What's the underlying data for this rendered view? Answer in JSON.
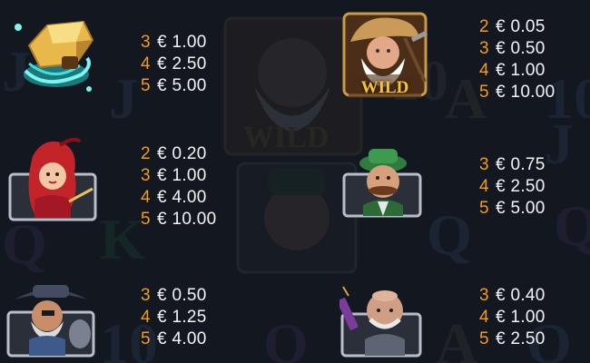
{
  "theme": {
    "count_color": "#f39c1f",
    "amount_color": "#f4f4f4",
    "background": "#121720"
  },
  "background_letters": [
    "J",
    "J",
    "A",
    "10",
    "10",
    "J",
    "K",
    "Q",
    "Q",
    "10",
    "Q",
    "Q",
    "A",
    "Q"
  ],
  "background_wild_label": "WILD",
  "paytable": [
    {
      "icon": "gold-nugget-icon",
      "pays": [
        {
          "count": "3",
          "amount": "€ 1.00"
        },
        {
          "count": "4",
          "amount": "€ 2.50"
        },
        {
          "count": "5",
          "amount": "€ 5.00"
        }
      ]
    },
    {
      "icon": "wild-miner-icon",
      "label": "WILD",
      "pays": [
        {
          "count": "2",
          "amount": "€ 0.05"
        },
        {
          "count": "3",
          "amount": "€ 0.50"
        },
        {
          "count": "4",
          "amount": "€ 1.00"
        },
        {
          "count": "5",
          "amount": "€ 10.00"
        }
      ]
    },
    {
      "icon": "red-haired-lady-icon",
      "pays": [
        {
          "count": "2",
          "amount": "€ 0.20"
        },
        {
          "count": "3",
          "amount": "€ 1.00"
        },
        {
          "count": "4",
          "amount": "€ 4.00"
        },
        {
          "count": "5",
          "amount": "€ 10.00"
        }
      ]
    },
    {
      "icon": "green-hat-man-icon",
      "pays": [
        {
          "count": "3",
          "amount": "€ 0.75"
        },
        {
          "count": "4",
          "amount": "€ 2.50"
        },
        {
          "count": "5",
          "amount": "€ 5.00"
        }
      ]
    },
    {
      "icon": "bandit-cowboy-icon",
      "pays": [
        {
          "count": "3",
          "amount": "€ 0.50"
        },
        {
          "count": "4",
          "amount": "€ 1.25"
        },
        {
          "count": "5",
          "amount": "€ 4.00"
        }
      ]
    },
    {
      "icon": "bald-dynamite-man-icon",
      "pays": [
        {
          "count": "3",
          "amount": "€ 0.40"
        },
        {
          "count": "4",
          "amount": "€ 1.00"
        },
        {
          "count": "5",
          "amount": "€ 2.50"
        }
      ]
    }
  ]
}
